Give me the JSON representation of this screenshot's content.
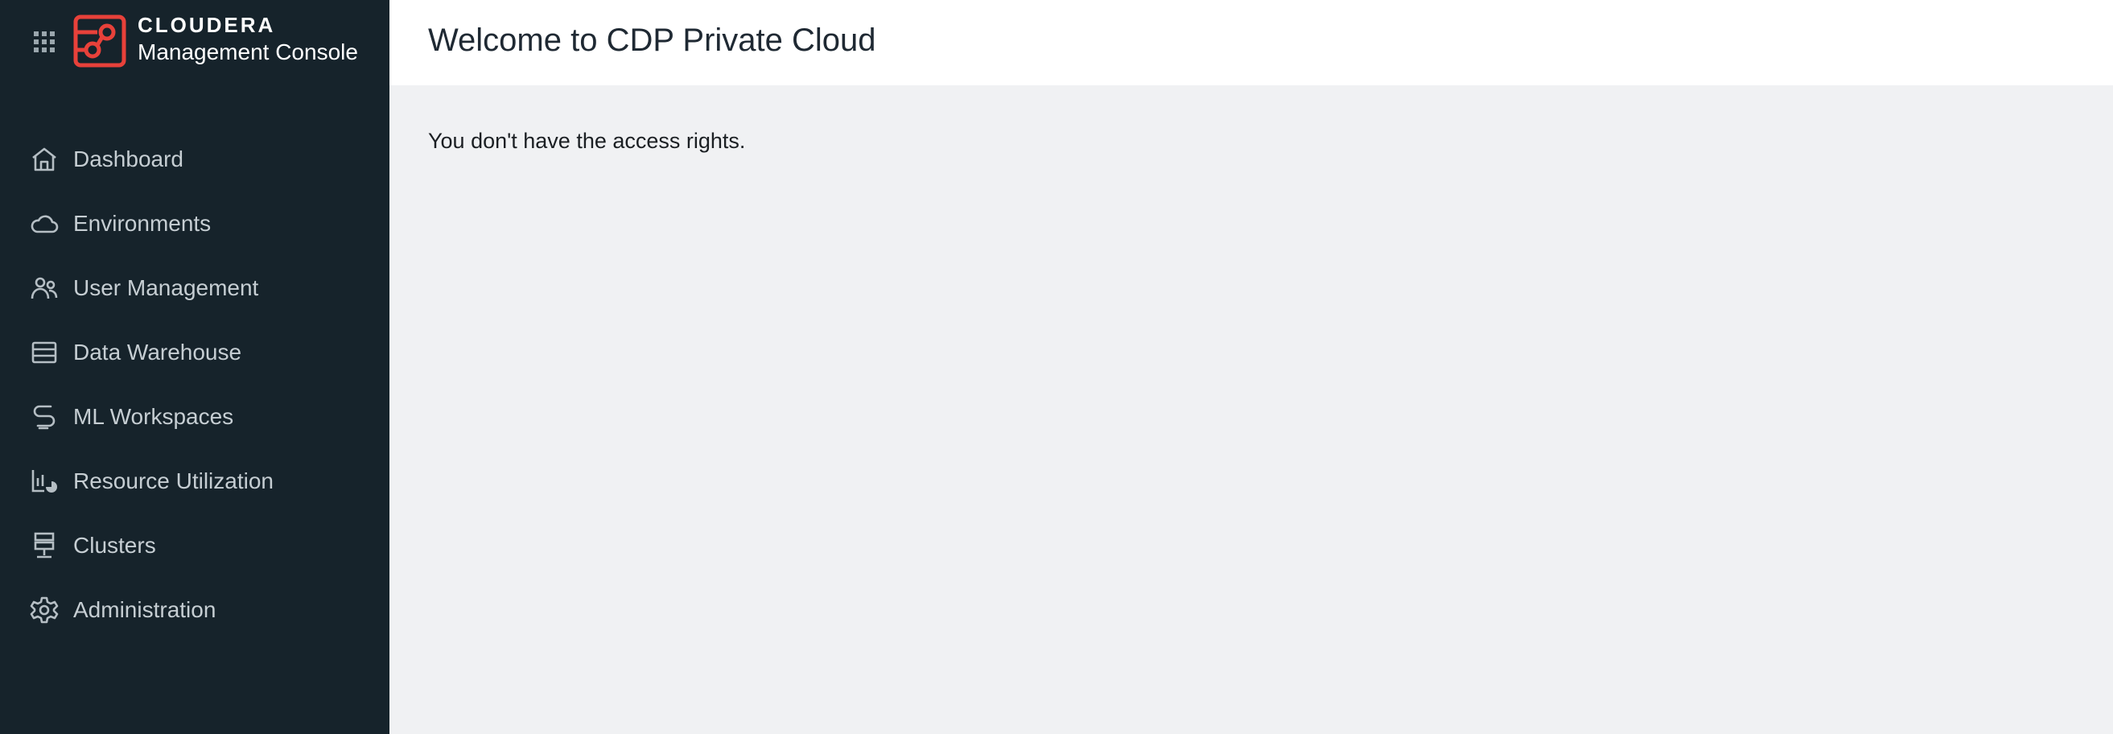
{
  "brand": {
    "name": "CLOUDERA",
    "product": "Management Console",
    "accent_color": "#e8413a",
    "logo_icon": "cloudera-logo-icon",
    "apps_icon": "app-grid-icon"
  },
  "sidebar": {
    "background": "#16232b",
    "items": [
      {
        "label": "Dashboard",
        "icon": "home-icon"
      },
      {
        "label": "Environments",
        "icon": "cloud-icon"
      },
      {
        "label": "User Management",
        "icon": "users-icon"
      },
      {
        "label": "Data Warehouse",
        "icon": "data-warehouse-icon"
      },
      {
        "label": "ML Workspaces",
        "icon": "ml-workspaces-icon"
      },
      {
        "label": "Resource Utilization",
        "icon": "resource-utilization-icon"
      },
      {
        "label": "Clusters",
        "icon": "clusters-icon"
      },
      {
        "label": "Administration",
        "icon": "gear-icon"
      }
    ]
  },
  "header": {
    "title": "Welcome to CDP Private Cloud"
  },
  "main": {
    "message": "You don't have the access rights."
  }
}
